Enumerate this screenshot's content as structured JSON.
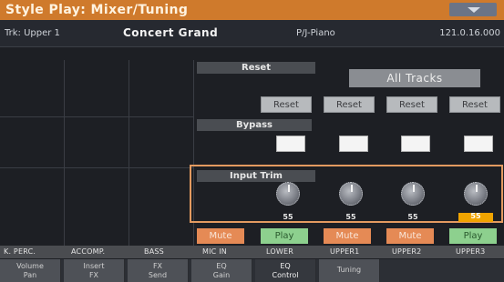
{
  "window": {
    "title": "Style Play: Mixer/Tuning",
    "menu_icon": "chevron-down-icon"
  },
  "info_bar": {
    "track": "Trk: Upper 1",
    "sound_name": "Concert Grand",
    "category": "P/J-Piano",
    "bank": "121.0.16.000"
  },
  "reset": {
    "label": "Reset",
    "all_tracks_label": "All Tracks",
    "buttons": [
      "Reset",
      "Reset",
      "Reset",
      "Reset"
    ]
  },
  "bypass": {
    "label": "Bypass",
    "states": [
      false,
      false,
      false,
      false
    ]
  },
  "input_trim": {
    "label": "Input Trim",
    "values": [
      "55",
      "55",
      "55",
      "55"
    ],
    "selected_index": 3
  },
  "modes": [
    "Mute",
    "Play",
    "Mute",
    "Mute",
    "Play"
  ],
  "tracks": [
    "K. PERC.",
    "ACCOMP.",
    "BASS",
    "MIC IN",
    "LOWER",
    "UPPER1",
    "UPPER2",
    "UPPER3"
  ],
  "tabs": [
    {
      "line1": "Volume",
      "line2": "Pan"
    },
    {
      "line1": "Insert",
      "line2": "FX"
    },
    {
      "line1": "FX",
      "line2": "Send"
    },
    {
      "line1": "EQ",
      "line2": "Gain"
    },
    {
      "line1": "EQ",
      "line2": "Control"
    },
    {
      "line1": "Tuning",
      "line2": ""
    }
  ],
  "active_tab": 4,
  "colors": {
    "title_bar": "#cf7a2c",
    "highlight": "#e39a60",
    "mute": "#e58a55",
    "play": "#8dd08e",
    "selected_value": "#f0a400"
  }
}
